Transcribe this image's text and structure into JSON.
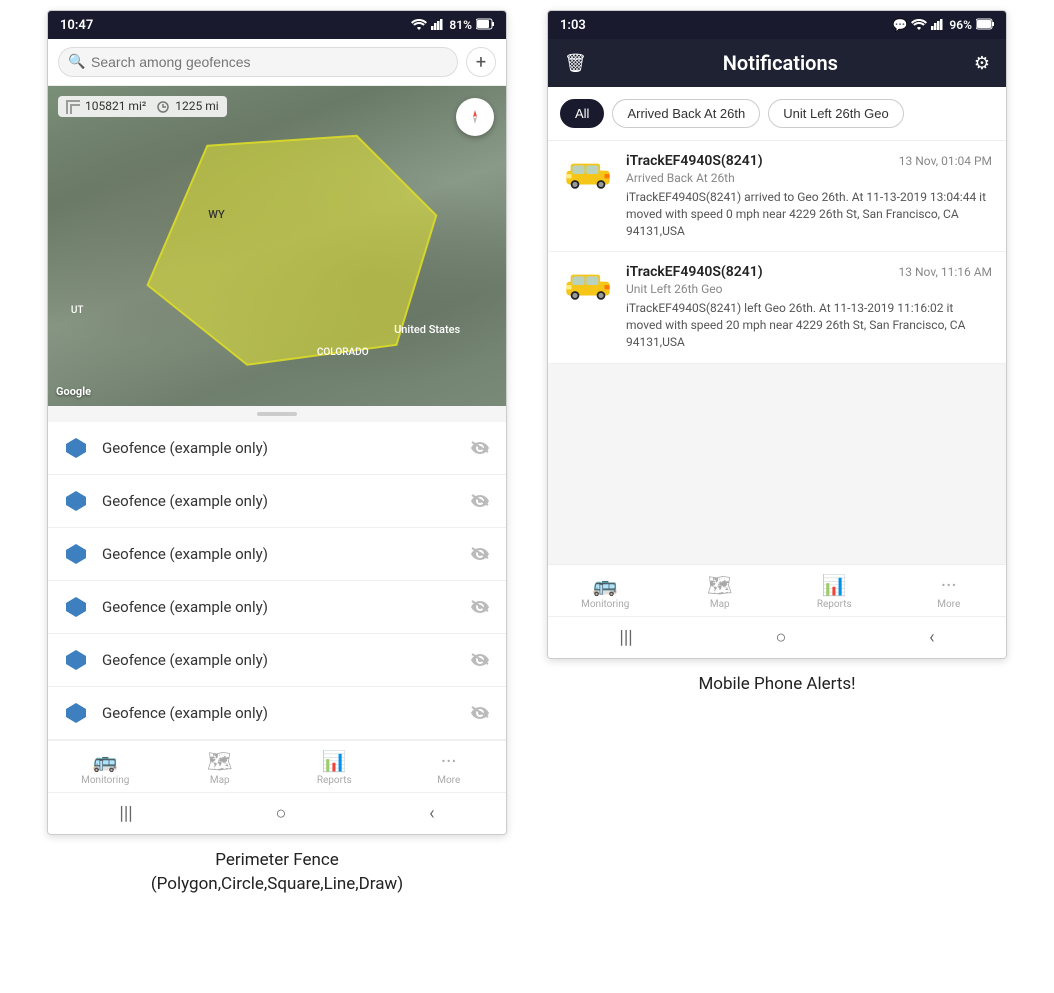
{
  "left_phone": {
    "status_bar": {
      "time": "10:47",
      "wifi": "WiFi",
      "signal": "Signal",
      "battery": "81%"
    },
    "search": {
      "placeholder": "Search among geofences"
    },
    "map": {
      "area": "105821 mi²",
      "distance": "1225 mi",
      "label_wy": "WY",
      "label_us": "United States",
      "label_co": "COLORADO",
      "label_ut": "UT",
      "brand": "Google"
    },
    "geofences": [
      {
        "name": "Geofence (example only)"
      },
      {
        "name": "Geofence (example only)"
      },
      {
        "name": "Geofence (example only)"
      },
      {
        "name": "Geofence (example only)"
      },
      {
        "name": "Geofence (example only)"
      },
      {
        "name": "Geofence (example only)"
      }
    ],
    "bottom_nav": [
      {
        "label": "Monitoring",
        "icon": "🚌"
      },
      {
        "label": "Map",
        "icon": "🗺"
      },
      {
        "label": "Reports",
        "icon": "📊"
      },
      {
        "label": "More",
        "icon": "···"
      }
    ],
    "android_nav": [
      "|||",
      "○",
      "<"
    ]
  },
  "right_phone": {
    "status_bar": {
      "time": "1:03",
      "chat": "💬",
      "wifi": "WiFi",
      "signal": "Signal",
      "battery": "96%"
    },
    "header": {
      "title": "Notifications",
      "delete_icon": "🗑",
      "settings_icon": "⚙"
    },
    "filter_tabs": [
      {
        "label": "All",
        "active": true
      },
      {
        "label": "Arrived Back At 26th",
        "active": false
      },
      {
        "label": "Unit Left 26th Geo",
        "active": false
      }
    ],
    "notifications": [
      {
        "device": "iTrackEF4940S(8241)",
        "time": "13 Nov, 01:04 PM",
        "event": "Arrived Back At 26th",
        "body": "iTrackEF4940S(8241) arrived to Geo 26th.    At 11-13-2019 13:04:44 it moved with speed 0 mph near 4229 26th St, San Francisco, CA 94131,USA"
      },
      {
        "device": "iTrackEF4940S(8241)",
        "time": "13 Nov, 11:16 AM",
        "event": "Unit Left 26th Geo",
        "body": "iTrackEF4940S(8241) left Geo 26th.   At 11-13-2019 11:16:02 it moved with speed 20 mph near 4229 26th St, San Francisco, CA 94131,USA"
      }
    ],
    "bottom_nav": [
      {
        "label": "Monitoring",
        "icon": "🚌"
      },
      {
        "label": "Map",
        "icon": "🗺"
      },
      {
        "label": "Reports",
        "icon": "📊"
      },
      {
        "label": "More",
        "icon": "···"
      }
    ],
    "android_nav": [
      "|||",
      "○",
      "<"
    ]
  },
  "captions": {
    "left": "Perimeter Fence\n(Polygon,Circle,Square,Line,Draw)",
    "right": "Mobile Phone Alerts!"
  }
}
